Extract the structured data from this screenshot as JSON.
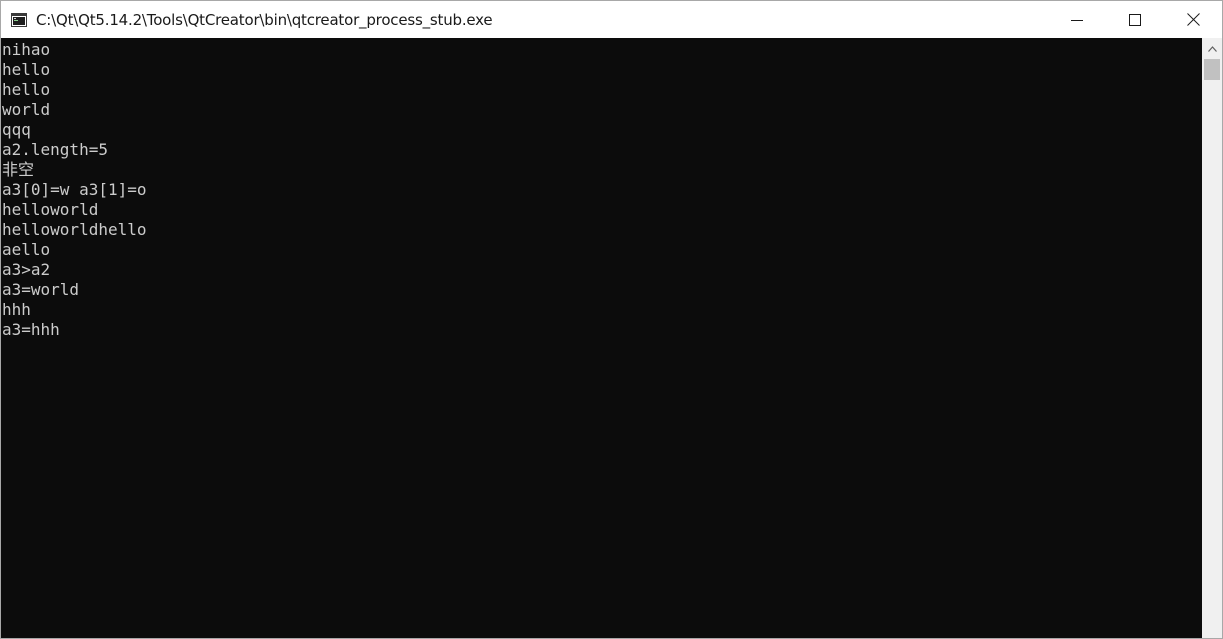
{
  "window": {
    "title": "C:\\Qt\\Qt5.14.2\\Tools\\QtCreator\\bin\\qtcreator_process_stub.exe",
    "icon": "console-window-icon",
    "controls": {
      "minimize_icon": "minimize-icon",
      "maximize_icon": "maximize-icon",
      "close_icon": "close-icon"
    }
  },
  "console": {
    "background": "#0c0c0c",
    "text_color": "#cccccc",
    "lines": [
      "nihao",
      "hello",
      "hello",
      "world",
      "qqq",
      "a2.length=5",
      "非空",
      "a3[0]=w a3[1]=o",
      "helloworld",
      "helloworldhello",
      "aello",
      "a3>a2",
      "a3=world",
      "hhh",
      "a3=hhh"
    ]
  },
  "scrollbar": {
    "up_arrow_icon": "chevron-up-icon",
    "track_color": "#f0f0f0",
    "thumb_color": "#c1c1c1"
  }
}
